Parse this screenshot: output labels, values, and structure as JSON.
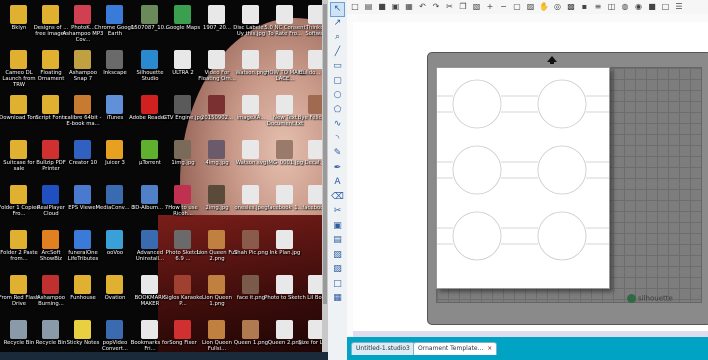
{
  "desktop": {
    "icons": [
      {
        "label": "Bklyn",
        "color": "#e0b030"
      },
      {
        "label": "Designs of ... free images",
        "color": "#e0b030"
      },
      {
        "label": "PhotoK... Ashampoo MP3 Cov...",
        "color": "#d04050"
      },
      {
        "label": "Chrome Google Earth",
        "color": "#3a7ad8"
      },
      {
        "label": "1507087_10...",
        "color": "#6a8a5a"
      },
      {
        "label": "Google Maps",
        "color": "#3aa050"
      },
      {
        "label": "1907_20...",
        "color": "#e8e8e8"
      },
      {
        "label": "Disc Labele... Uy this.jpg",
        "color": "#e8e8e8"
      },
      {
        "label": "5.0 NC Consent To Rate Fro...",
        "color": "#e8e8e8"
      },
      {
        "label": "Thinkc... Software",
        "color": "#e8e8e8"
      },
      {
        "label": "Cameo DL Launch from TRW",
        "color": "#e0b030"
      },
      {
        "label": "Floating Ornament",
        "color": "#e0b030"
      },
      {
        "label": "Ashampoo Snap 7",
        "color": "#c0a040"
      },
      {
        "label": "Inkscape",
        "color": "#6a6a6a"
      },
      {
        "label": "Silhouette Studio",
        "color": "#2a8ad0"
      },
      {
        "label": "ULTRA 2",
        "color": "#e8e8e8"
      },
      {
        "label": "Video For Floating Orn...",
        "color": "#e8e8e8"
      },
      {
        "label": "Watson.png",
        "color": "#e8e8e8"
      },
      {
        "label": "HOW TO MAKE LACE...",
        "color": "#e8e8e8"
      },
      {
        "label": "Bulldo... wrap",
        "color": "#e8e8e8"
      },
      {
        "label": "Download Tons",
        "color": "#e0b030"
      },
      {
        "label": "Script Fonts",
        "color": "#e0b030"
      },
      {
        "label": "calibre 64bit - E-book ma...",
        "color": "#c87a30"
      },
      {
        "label": "iTunes",
        "color": "#6090d8"
      },
      {
        "label": "Adobe Reader...",
        "color": "#d02020"
      },
      {
        "label": "GTV Engine.jpg",
        "color": "#5a5a5a"
      },
      {
        "label": "20150902...",
        "color": "#7a3030"
      },
      {
        "label": "imageXA...",
        "color": "#e8e8e8"
      },
      {
        "label": "New Text Document.txt",
        "color": "#e8e8e8"
      },
      {
        "label": "Bye Felicia.p...",
        "color": "#a06a50"
      },
      {
        "label": "Suitcase for sale",
        "color": "#e0b030"
      },
      {
        "label": "Bullzip PDF Printer",
        "color": "#d03030"
      },
      {
        "label": "Creator 10",
        "color": "#3060c0"
      },
      {
        "label": "Juicer 3",
        "color": "#e8a020"
      },
      {
        "label": "µTorrent",
        "color": "#60b030"
      },
      {
        "label": "1img.jpg",
        "color": "#7a6a5a"
      },
      {
        "label": "4img.jpg",
        "color": "#6a5a6a"
      },
      {
        "label": "Watson.svg",
        "color": "#e8e8e8"
      },
      {
        "label": "IMG_0001.jpg",
        "color": "#9a7a6a"
      },
      {
        "label": "Decal.jpg",
        "color": "#e8e8e8"
      },
      {
        "label": "Folder 1 Copied Fro...",
        "color": "#e0b030"
      },
      {
        "label": "RealPlayer Cloud",
        "color": "#2050c0"
      },
      {
        "label": "EPS Viewer",
        "color": "#4a7ad0"
      },
      {
        "label": "MediaConv... 8",
        "color": "#3a6ab0"
      },
      {
        "label": "3D-Album... 7",
        "color": "#5080c8"
      },
      {
        "label": "How to use Ricoh...",
        "color": "#c03050"
      },
      {
        "label": "2img.jpg",
        "color": "#5a4a3a"
      },
      {
        "label": "onesies.jpeg",
        "color": "#e8e8e8"
      },
      {
        "label": "facebook_1...",
        "color": "#e8e8e8"
      },
      {
        "label": "facebook...",
        "color": "#e8e8e8"
      },
      {
        "label": "Folder 2 Paste from...",
        "color": "#e0b030"
      },
      {
        "label": "ArcSoft ShowBiz",
        "color": "#e08020"
      },
      {
        "label": "funeralOne LifeTributes",
        "color": "#3a7ad8"
      },
      {
        "label": "ooVoo",
        "color": "#3aa0d8"
      },
      {
        "label": "Advanced Uninstall...",
        "color": "#3a6ab0"
      },
      {
        "label": "Photo Sketch 6.9 ...",
        "color": "#6a6a6a"
      },
      {
        "label": "Lion Queen Full 2.png",
        "color": "#c08040"
      },
      {
        "label": "Shah Pic.png",
        "color": "#8a5a4a"
      },
      {
        "label": "Ink Plan.jpg",
        "color": "#e8e8e8"
      },
      {
        "label": "",
        "color": "#000000"
      },
      {
        "label": "From Red Flash Drive",
        "color": "#e0b030"
      },
      {
        "label": "Ashampoo Burning...",
        "color": "#c03030"
      },
      {
        "label": "Funhouse",
        "color": "#e0b030"
      },
      {
        "label": "Ovation",
        "color": "#e0b030"
      },
      {
        "label": "BOOKMARK MAKER",
        "color": "#e8e8e8"
      },
      {
        "label": "Siglos Karaoke P...",
        "color": "#a04030"
      },
      {
        "label": "Lion Queen 1.png",
        "color": "#c08040"
      },
      {
        "label": "face it.png",
        "color": "#7a5a4a"
      },
      {
        "label": "Photo to Sketch",
        "color": "#e8e8e8"
      },
      {
        "label": "Lil Bo...",
        "color": "#e8e8e8"
      },
      {
        "label": "Recycle Bin",
        "color": "#8a9aa8"
      },
      {
        "label": "Recycle Bin",
        "color": "#8a9aa8"
      },
      {
        "label": "Sticky Notes",
        "color": "#e8d040"
      },
      {
        "label": "popVideo Convert...",
        "color": "#3a6ab0"
      },
      {
        "label": "Bookmarks for Fri...",
        "color": "#e8e8e8"
      },
      {
        "label": "Song Fixer",
        "color": "#d03030"
      },
      {
        "label": "Lion Queen Fullsi...",
        "color": "#c08040"
      },
      {
        "label": "Queen 1.png",
        "color": "#b07a50"
      },
      {
        "label": "Queen 2.png",
        "color": "#e8e8e8"
      },
      {
        "label": "Size for Lion...",
        "color": "#e8e8e8"
      }
    ]
  },
  "app": {
    "tools": [
      {
        "name": "select-tool-icon",
        "glyph": "↖"
      },
      {
        "name": "point-edit-icon",
        "glyph": "↗"
      },
      {
        "name": "zoom-icon",
        "glyph": "⌕"
      },
      {
        "name": "line-tool-icon",
        "glyph": "╱"
      },
      {
        "name": "rectangle-tool-icon",
        "glyph": "▭"
      },
      {
        "name": "rounded-rect-icon",
        "glyph": "▢"
      },
      {
        "name": "ellipse-tool-icon",
        "glyph": "○"
      },
      {
        "name": "polygon-tool-icon",
        "glyph": "⬠"
      },
      {
        "name": "curve-tool-icon",
        "glyph": "∿"
      },
      {
        "name": "arc-tool-icon",
        "glyph": "◝"
      },
      {
        "name": "freehand-tool-icon",
        "glyph": "✎"
      },
      {
        "name": "smooth-freehand-icon",
        "glyph": "✒"
      },
      {
        "name": "text-tool-icon",
        "glyph": "A"
      },
      {
        "name": "eraser-tool-icon",
        "glyph": "⌫"
      },
      {
        "name": "knife-tool-icon",
        "glyph": "✂"
      },
      {
        "name": "library-icon",
        "glyph": "▣"
      },
      {
        "name": "store-icon",
        "glyph": "▤"
      },
      {
        "name": "cut-settings-icon",
        "glyph": "▧"
      },
      {
        "name": "send-to-cutter-icon",
        "glyph": "▨"
      },
      {
        "name": "page-setup-icon",
        "glyph": "□"
      },
      {
        "name": "registration-icon",
        "glyph": "▦"
      }
    ],
    "top_tools": [
      "new-icon",
      "open-icon",
      "save-icon",
      "print-icon",
      "print-cut-icon",
      "undo-icon",
      "redo-icon",
      "cut-icon",
      "copy-icon",
      "paste-icon",
      "zoom-in-icon",
      "zoom-out-icon",
      "zoom-box-icon",
      "fit-icon",
      "pan-icon",
      "weld-icon",
      "group-icon",
      "ungroup-icon",
      "align-icon",
      "replicate-icon",
      "offset-icon",
      "trace-icon",
      "fill-icon",
      "line-color-icon",
      "layers-icon"
    ],
    "tabs": [
      {
        "label": "Untitled-1.studio3",
        "active": false
      },
      {
        "label": "Ornament Template...",
        "active": true
      }
    ],
    "mat_logo": "silhouette",
    "colors": {
      "brand": "#00a3c4",
      "mat": "#8a8a8a",
      "cut_line": "#e8a8b8"
    }
  }
}
